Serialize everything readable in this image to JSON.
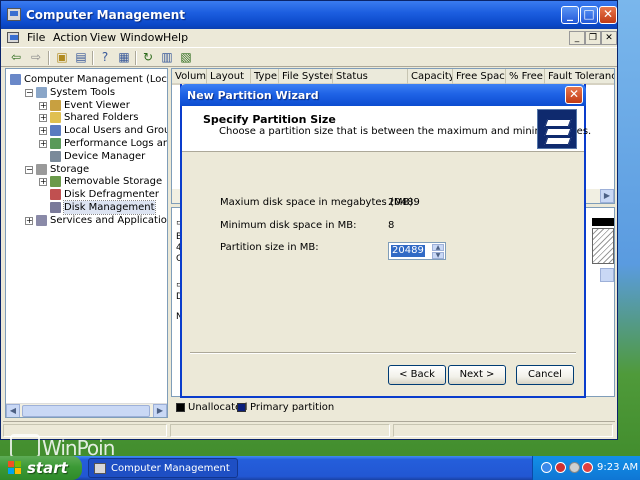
{
  "main_window": {
    "title": "Computer Management",
    "menu": [
      "File",
      "Action",
      "View",
      "Window",
      "Help"
    ]
  },
  "tree": {
    "items": [
      {
        "label": "Computer Management (Local)",
        "indent": 0,
        "expander": "",
        "icon_color": "#6a88c8"
      },
      {
        "label": "System Tools",
        "indent": 1,
        "expander": "−",
        "icon_color": "#8aa6c8"
      },
      {
        "label": "Event Viewer",
        "indent": 2,
        "expander": "+",
        "icon_color": "#c8a040"
      },
      {
        "label": "Shared Folders",
        "indent": 2,
        "expander": "+",
        "icon_color": "#e0c050"
      },
      {
        "label": "Local Users and Groups",
        "indent": 2,
        "expander": "+",
        "icon_color": "#5a7ac0"
      },
      {
        "label": "Performance Logs and Alerts",
        "indent": 2,
        "expander": "+",
        "icon_color": "#5a9a5a"
      },
      {
        "label": "Device Manager",
        "indent": 2,
        "expander": "",
        "icon_color": "#7a8a9a"
      },
      {
        "label": "Storage",
        "indent": 1,
        "expander": "−",
        "icon_color": "#9a9a9a"
      },
      {
        "label": "Removable Storage",
        "indent": 2,
        "expander": "+",
        "icon_color": "#6a9a4a"
      },
      {
        "label": "Disk Defragmenter",
        "indent": 2,
        "expander": "",
        "icon_color": "#c05050"
      },
      {
        "label": "Disk Management",
        "indent": 2,
        "expander": "",
        "icon_color": "#7a7a9a",
        "selected": true
      },
      {
        "label": "Services and Applications",
        "indent": 1,
        "expander": "+",
        "icon_color": "#8a8aa8"
      }
    ]
  },
  "list": {
    "columns": [
      "Volume",
      "Layout",
      "Type",
      "File System",
      "Status",
      "Capacity",
      "Free Space",
      "% Free",
      "Fault Tolerance"
    ]
  },
  "graph": {
    "disk_letters_1": [
      "B",
      "4",
      "O"
    ],
    "disk_letters_2": [
      "D",
      "N"
    ]
  },
  "legend": {
    "items": [
      {
        "label": "Unallocated",
        "color": "#000000"
      },
      {
        "label": "Primary partition",
        "color": "#0a1e7a"
      }
    ]
  },
  "wizard": {
    "title": "New Partition Wizard",
    "heading": "Specify Partition Size",
    "subheading": "Choose a partition size that is between the maximum and minimum sizes.",
    "max_label": "Maxium disk space in megabytes (MB):",
    "max_value": "20489",
    "min_label": "Minimum disk space in MB:",
    "min_value": "8",
    "size_label": "Partition size in MB:",
    "size_value": "20489",
    "back_label": "< Back",
    "next_label": "Next >",
    "cancel_label": "Cancel"
  },
  "desktop": {
    "watermark": "WinPoin"
  },
  "taskbar": {
    "start_label": "start",
    "task_label": "Computer Management",
    "clock": "9:23 AM"
  }
}
